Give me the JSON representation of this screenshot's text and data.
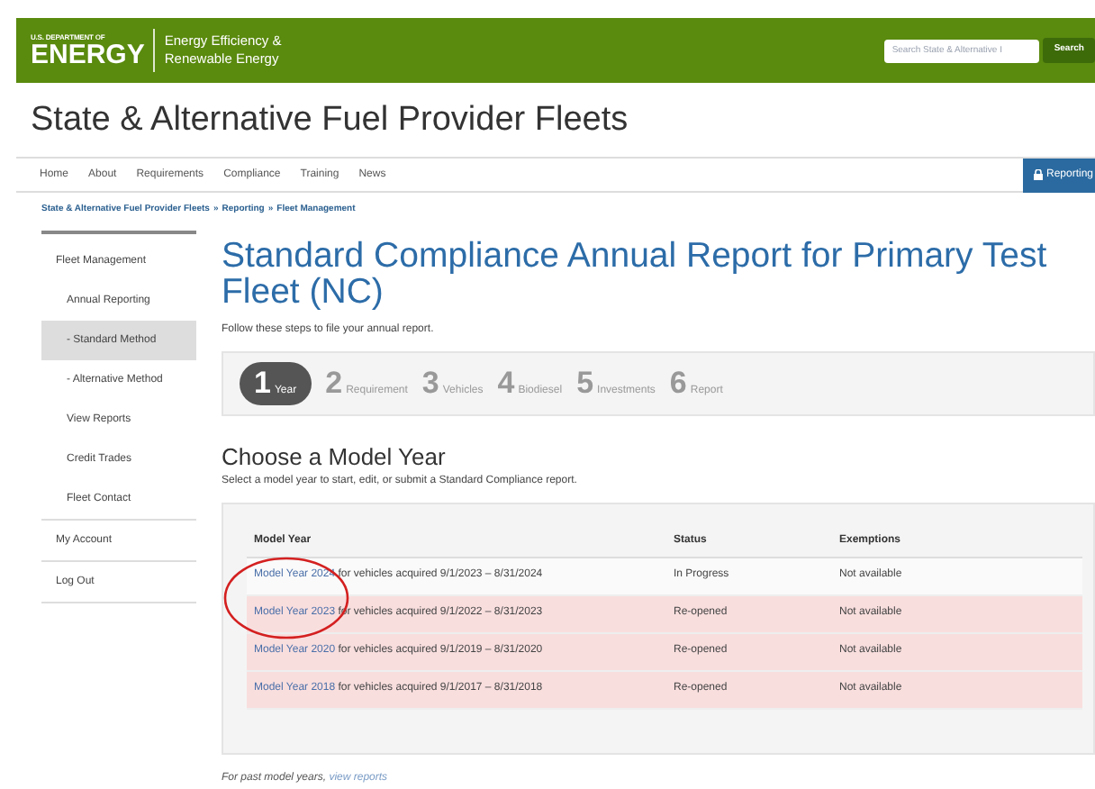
{
  "header": {
    "agency_top": "U.S. DEPARTMENT OF",
    "agency": "ENERGY",
    "office": [
      "Energy Efficiency &",
      "Renewable Energy"
    ],
    "search": {
      "placeholder": "Search State & Alternative I"
    },
    "search_button": "Search"
  },
  "site_title": "State & Alternative Fuel Provider Fleets",
  "nav": {
    "items": [
      "Home",
      "About",
      "Requirements",
      "Compliance",
      "Training",
      "News"
    ],
    "reporting_button": "Reporting"
  },
  "breadcrumb": [
    "State & Alternative Fuel Provider Fleets",
    "Reporting",
    "Fleet Management"
  ],
  "breadcrumb_separator": "»",
  "sidebar": {
    "items": [
      {
        "label": "Fleet Management",
        "selected": false,
        "children": [
          {
            "label": "Annual Reporting",
            "selected": false
          },
          {
            "label": "- Standard Method",
            "selected": true
          },
          {
            "label": "- Alternative Method",
            "selected": false
          },
          {
            "label": "View Reports",
            "selected": false
          },
          {
            "label": "Credit Trades",
            "selected": false
          },
          {
            "label": "Fleet Contact",
            "selected": false
          }
        ]
      },
      {
        "label": "My Account",
        "selected": false
      },
      {
        "label": "Log Out",
        "selected": false
      }
    ]
  },
  "page_title": "Standard Compliance Annual Report for Primary Test Fleet (NC)",
  "intro": "Follow these steps to file your annual report.",
  "steps": [
    {
      "number": "1",
      "label": "Year",
      "selected": true
    },
    {
      "number": "2",
      "label": "Requirement",
      "selected": false
    },
    {
      "number": "3",
      "label": "Vehicles",
      "selected": false
    },
    {
      "number": "4",
      "label": "Biodiesel",
      "selected": false
    },
    {
      "number": "5",
      "label": "Investments",
      "selected": false
    },
    {
      "number": "6",
      "label": "Report",
      "selected": false
    }
  ],
  "section_title": "Choose a Model Year",
  "section_text": "Select a model year to start, edit, or submit a Standard Compliance report.",
  "table": {
    "columns": [
      "Model Year",
      "Status",
      "Exemptions"
    ],
    "rows": [
      {
        "link": "Model Year 2024",
        "text": " for vehicles acquired 9/1/2023 – 8/31/2024",
        "status": "In Progress",
        "exemptions": "Not available",
        "highlighted": false
      },
      {
        "link": "Model Year 2023",
        "text": " for vehicles acquired 9/1/2022 – 8/31/2023",
        "status": "Re-opened",
        "exemptions": "Not available",
        "highlighted": true
      },
      {
        "link": "Model Year 2020",
        "text": " for vehicles acquired 9/1/2019 – 8/31/2020",
        "status": "Re-opened",
        "exemptions": "Not available",
        "highlighted": true
      },
      {
        "link": "Model Year 2018",
        "text": " for vehicles acquired 9/1/2017 – 8/31/2018",
        "status": "Re-opened",
        "exemptions": "Not available",
        "highlighted": true
      }
    ]
  },
  "footer_note": {
    "text": "For past model years, ",
    "link": "view reports"
  }
}
